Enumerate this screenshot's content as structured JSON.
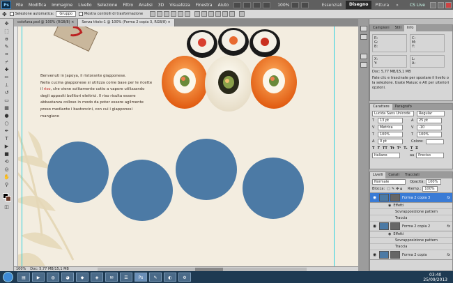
{
  "menubar": {
    "logo": "Ps",
    "items": [
      "File",
      "Modifica",
      "Immagine",
      "Livello",
      "Selezione",
      "Filtro",
      "Analisi",
      "3D",
      "Visualizza",
      "Finestra",
      "Aiuto"
    ],
    "zoom": "100%",
    "workspaces": [
      "Essenziali",
      "Disegno",
      "Pittura"
    ],
    "active_workspace": "Disegno",
    "cslive": "CS Live"
  },
  "options": {
    "auto_select_label": "Selezione automatica:",
    "auto_select_value": "Gruppo",
    "transform_label": "Mostra controlli di trasformazione"
  },
  "tabs": [
    {
      "label": "colofuna.psd @ 100% (RGB/8) ×",
      "active": false
    },
    {
      "label": "Senza titolo-1 @ 100% (Forma 2 copia 3, RGB/8) ×",
      "active": true
    }
  ],
  "document": {
    "text_lines": [
      "Benvenuti in Japoya, il ristorante giapponese.",
      "Nella cucina giapponese si utilizza come base per le ricette",
      "il ",
      "riso",
      ", che viene solitamente cotto a vapore utilizzando",
      "degli appositi bollitori elettrici. Il riso risulta essere",
      "abbastanza colloso in modo da poter essere agilmente",
      "preso mediante i bastoncini, con cui i giapponesi",
      "mangiano"
    ],
    "circle_color": "#4c7aa5",
    "circle_count": 4
  },
  "status": {
    "zoom": "100%",
    "doc": "Doc: 5,77 MB/15,1 MB"
  },
  "info_panel": {
    "tabs": [
      "Campioni",
      "Stili",
      "Info"
    ],
    "active_tab": "Info",
    "doc": "Doc: 5,77 MB/15,1 MB",
    "hint": "Fate clic e trascinate per spostare il livello o la selezione. Usate Maiusc e Alt per ulteriori opzioni."
  },
  "char_panel": {
    "tabs": [
      "Carattere",
      "Paragrafo"
    ],
    "font": "Lucida Sans Unicode",
    "style": "Regular",
    "size": "13 pt",
    "leading": "25 pt",
    "kerning": "Metrica",
    "tracking": "-10",
    "vscale": "100%",
    "hscale": "100%",
    "baseline": "0 pt",
    "color_label": "Colore:",
    "language": "Italiano",
    "aa": "Preciso"
  },
  "layers_panel": {
    "tabs": [
      "Livelli",
      "Canali",
      "Tracciati"
    ],
    "blend": "Normale",
    "opacity_label": "Opacità:",
    "opacity": "100%",
    "lock_label": "Blocca:",
    "fill_label": "Riemp.:",
    "fill": "100%",
    "layers": [
      {
        "name": "Forma 2 copia 3",
        "selected": true,
        "effects": [
          "Effetti",
          "Sovrapposizione pattern",
          "Traccia"
        ]
      },
      {
        "name": "Forma 2 copia 2",
        "selected": false,
        "effects": [
          "Effetti",
          "Sovrapposizione pattern",
          "Traccia"
        ]
      },
      {
        "name": "Forma 2 copia",
        "selected": false,
        "effects": []
      }
    ]
  },
  "taskbar": {
    "time": "03:40",
    "date": "25/09/2013"
  }
}
